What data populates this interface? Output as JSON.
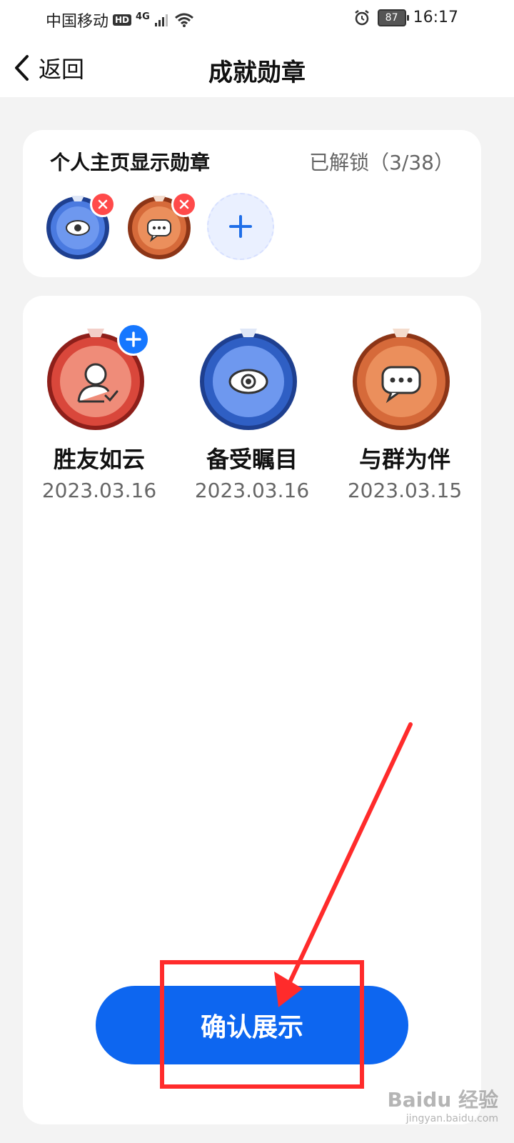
{
  "status_bar": {
    "carrier": "中国移动",
    "hd_badge": "HD",
    "network": "4G",
    "battery": "87",
    "time": "16:17"
  },
  "nav": {
    "back_label": "返回",
    "title": "成就勋章"
  },
  "display_card": {
    "title": "个人主页显示勋章",
    "unlocked": "已解锁（3/38）",
    "selected": [
      {
        "icon": "eye-icon",
        "color": "#2f5fc4"
      },
      {
        "icon": "chat-bubble-icon",
        "color": "#d66a3a"
      }
    ]
  },
  "medals": [
    {
      "name": "胜友如云",
      "date": "2023.03.16",
      "icon": "person-check-icon",
      "color": "#d9473b"
    },
    {
      "name": "备受瞩目",
      "date": "2023.03.16",
      "icon": "eye-icon",
      "color": "#2f5fc4"
    },
    {
      "name": "与群为伴",
      "date": "2023.03.15",
      "icon": "chat-bubble-icon",
      "color": "#d66a3a"
    }
  ],
  "confirm_button": "确认展示",
  "watermark": {
    "main": "Baidu 经验",
    "sub": "jingyan.baidu.com"
  },
  "colors": {
    "primary": "#0d66f0",
    "annotation": "#ff2b2b",
    "remove": "#ff4a4a"
  }
}
